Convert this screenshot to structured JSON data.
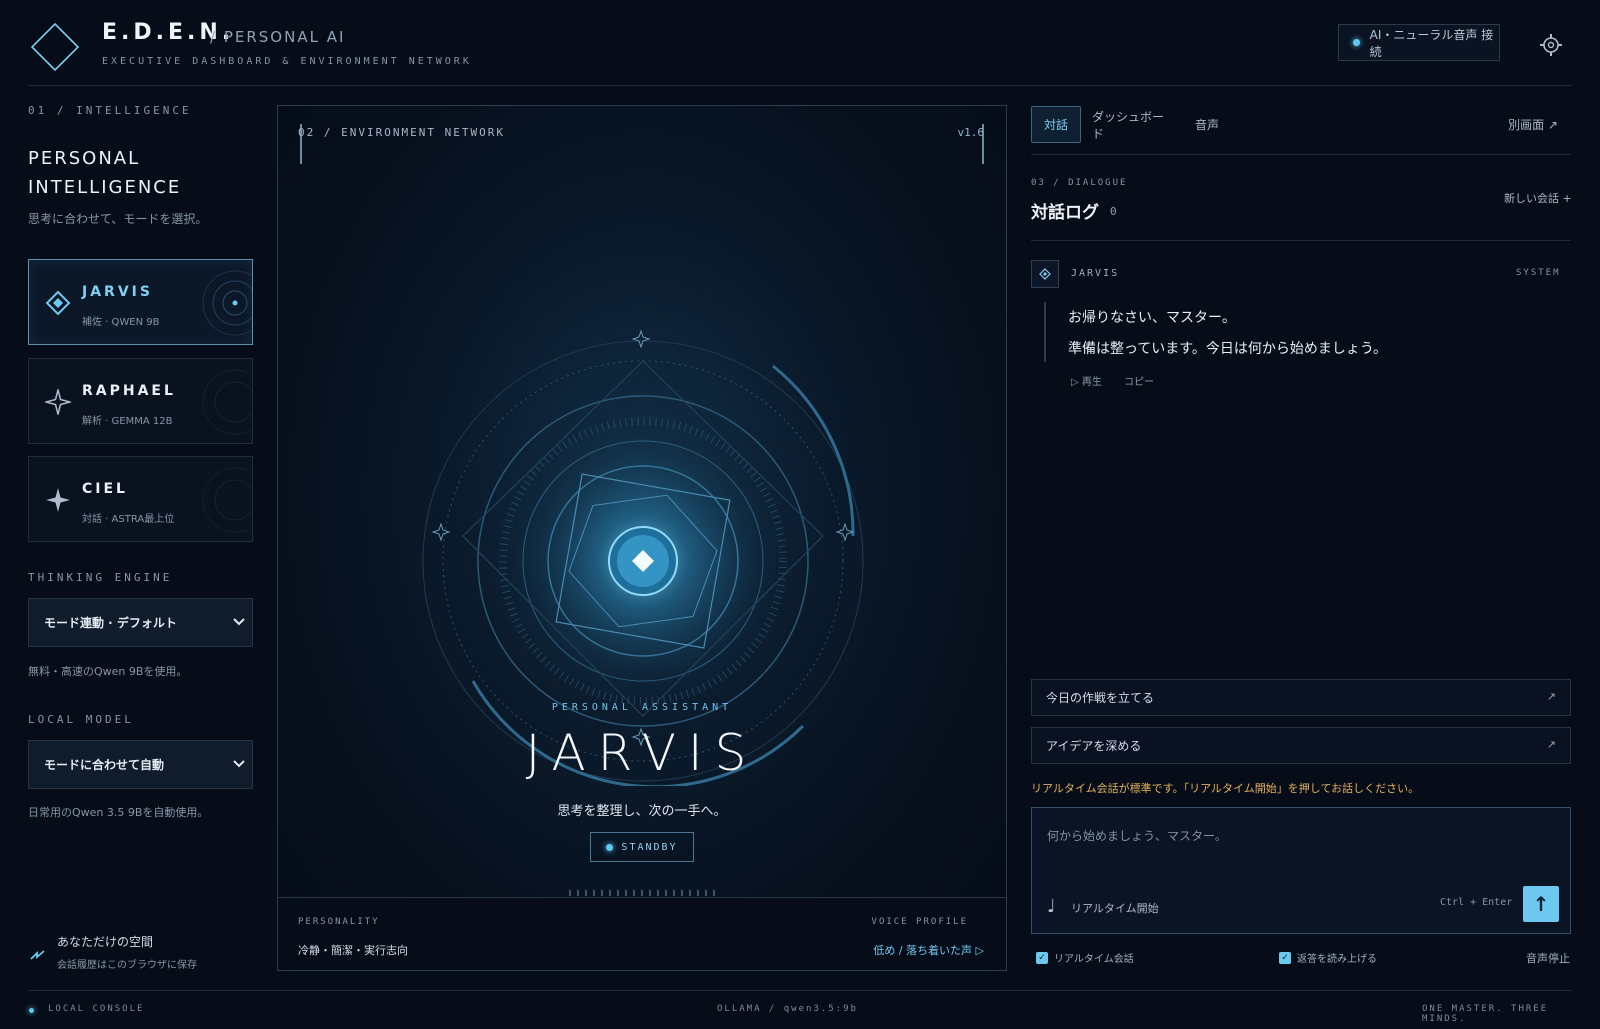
{
  "header": {
    "brand": "E.D.E.N.",
    "brand_sub": "/ PERSONAL AI",
    "tagline": "EXECUTIVE DASHBOARD & ENVIRONMENT NETWORK",
    "status": "AI・ニューラル音声 接続",
    "settings_icon": "gear-icon"
  },
  "left": {
    "section_label": "01 / INTELLIGENCE",
    "title_line1": "PERSONAL",
    "title_line2": "INTELLIGENCE",
    "subtitle": "思考に合わせて、モードを選択。",
    "modes": [
      {
        "name": "JARVIS",
        "meta": "補佐 · QWEN 9B",
        "icon": "diamond-icon",
        "active": true
      },
      {
        "name": "RAPHAEL",
        "meta": "解析 · GEMMA 12B",
        "icon": "sparkle-outline-icon",
        "active": false
      },
      {
        "name": "CIEL",
        "meta": "対話 · ASTRA最上位",
        "icon": "sparkle-filled-icon",
        "active": false
      }
    ],
    "thinking_label": "THINKING ENGINE",
    "thinking_value": "モード連動 · デフォルト",
    "thinking_note": "無料・高速のQwen 9Bを使用。",
    "model_label": "LOCAL MODEL",
    "model_value": "モードに合わせて自動",
    "model_note": "日常用のQwen 3.5 9Bを自動使用。",
    "space_title": "あなただけの空間",
    "space_sub": "会話履歴はこのブラウザに保存"
  },
  "center": {
    "header": "02 / ENVIRONMENT NETWORK",
    "version": "v1.6",
    "assistant_label": "PERSONAL ASSISTANT",
    "assistant_name": "JARVIS",
    "assistant_tagline": "思考を整理し、次の一手へ。",
    "status": "STANDBY",
    "personality_label": "PERSONALITY",
    "personality_value": "冷静・簡潔・実行志向",
    "voice_label": "VOICE PROFILE",
    "voice_value": "低め / 落ち着いた声 ▷"
  },
  "right": {
    "tabs": [
      "対話",
      "ダッシュボード",
      "音声"
    ],
    "popout": "別画面 ↗",
    "dialogue_label": "03 / DIALOGUE",
    "dialogue_title": "対話ログ",
    "dialogue_count": "0",
    "new_conversation": "新しい会話 +",
    "message": {
      "sender": "JARVIS",
      "role": "SYSTEM",
      "line1": "お帰りなさい、マスター。",
      "line2": "準備は整っています。今日は何から始めましょう。",
      "play": "▷ 再生",
      "copy": "コピー"
    },
    "suggestions": [
      "今日の作戦を立てる",
      "アイデアを深める"
    ],
    "suggestion_arrow": "↗",
    "warning": "リアルタイム会話が標準です。「リアルタイム開始」を押してお話しください。",
    "input_placeholder": "何から始めましょう、マスター。",
    "realtime_start": "リアルタイム開始",
    "shortcut": "Ctrl + Enter",
    "send_icon": "↑",
    "check_realtime": "リアルタイム会話",
    "check_readout": "返答を読み上げる",
    "stop_voice": "音声停止"
  },
  "footer": {
    "left": "LOCAL CONSOLE",
    "center": "OLLAMA / qwen3.5:9b",
    "right": "ONE MASTER. THREE MINDS."
  },
  "colors": {
    "accent": "#6cc8ef",
    "background": "#060c18",
    "warning": "#e3b15a"
  }
}
